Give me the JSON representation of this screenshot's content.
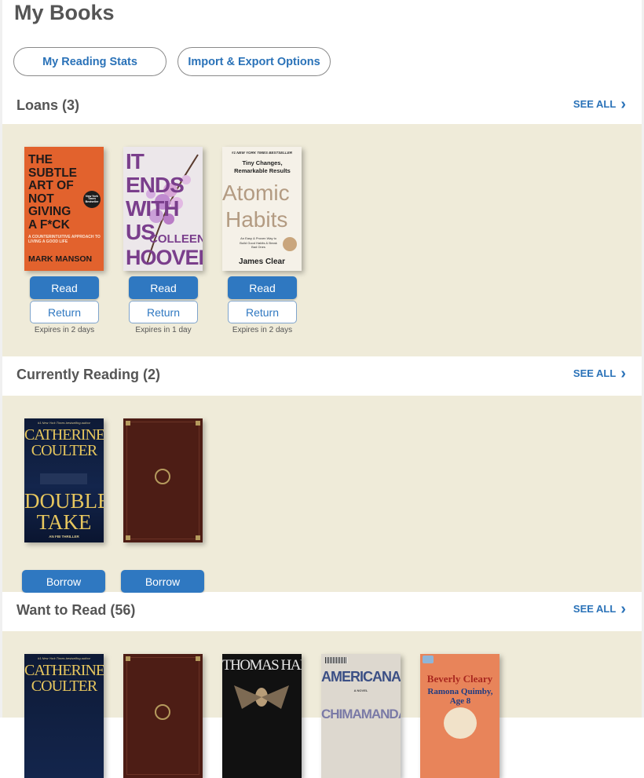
{
  "page": {
    "title": "My Books"
  },
  "top_buttons": {
    "stats": "My Reading Stats",
    "import_export": "Import & Export Options"
  },
  "sections": {
    "loans": {
      "title": "Loans (3)",
      "see_all": "SEE ALL",
      "books": [
        {
          "cover_lines": [
            "THE",
            "SUBTLE",
            "ART OF",
            "NOT",
            "GIVING",
            "A F*CK"
          ],
          "cover_sub": "A COUNTERINTUITIVE APPROACH TO LIVING A GOOD LIFE",
          "cover_author": "MARK MANSON",
          "cover_badge": "New York Times Bestseller",
          "read": "Read",
          "return": "Return",
          "expires": "Expires in 2 days"
        },
        {
          "cover_lines": [
            "IT ENDS",
            "WITH",
            "US"
          ],
          "cover_author_1": "COLLEEN",
          "cover_author_2": "HOOVER",
          "read": "Read",
          "return": "Return",
          "expires": "Expires in 1 day"
        },
        {
          "cover_top": "#1 NEW YORK TIMES BESTSELLER",
          "cover_sub": "Tiny Changes, Remarkable Results",
          "cover_lines": [
            "Atomic",
            "Habits"
          ],
          "cover_tag": "An Easy & Proven Way to Build Good Habits & Break Bad Ones",
          "cover_author": "James Clear",
          "read": "Read",
          "return": "Return",
          "expires": "Expires in 2 days"
        }
      ]
    },
    "currently_reading": {
      "title": "Currently Reading (2)",
      "see_all": "SEE ALL",
      "books": [
        {
          "cover_top": "#1 New York Times bestselling author",
          "cover_author_lines": [
            "CATHERINE",
            "COULTER"
          ],
          "cover_title_lines": [
            "DOUBLE",
            "TAKE"
          ],
          "cover_sub": "AN FBI THRILLER",
          "action": "Borrow"
        },
        {
          "action": "Borrow"
        }
      ]
    },
    "want_to_read": {
      "title": "Want to Read (56)",
      "see_all": "SEE ALL",
      "books": [
        {
          "cover_top": "#1 New York Times bestselling author",
          "cover_author_lines": [
            "CATHERINE",
            "COULTER"
          ]
        },
        {},
        {
          "cover_author": "THOMAS HARRIS"
        },
        {
          "cover_title": "AMERICANAH",
          "cover_sub": "A NOVEL",
          "cover_author": "CHIMAMANDA"
        },
        {
          "cover_author": "Beverly Cleary",
          "cover_title": "Ramona Quimby, Age 8"
        }
      ]
    }
  }
}
